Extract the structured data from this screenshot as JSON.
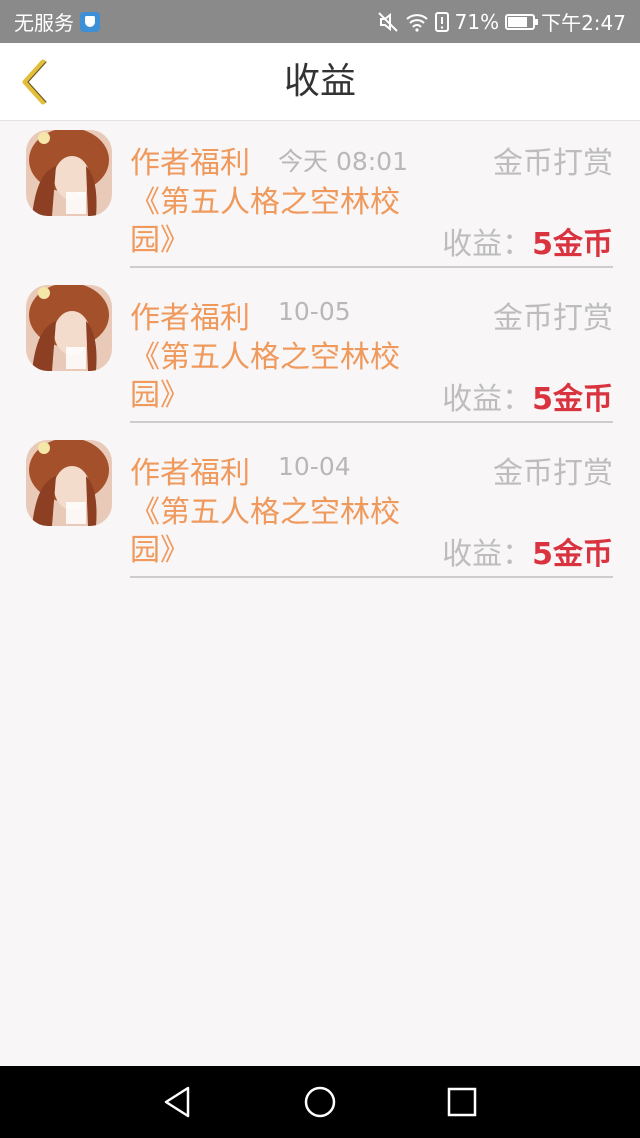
{
  "status_bar": {
    "carrier": "无服务",
    "battery": "71%",
    "battery_level": 0.71,
    "time": "下午2:47",
    "icons": [
      "shield-icon",
      "mute-icon",
      "wifi-icon",
      "alert-icon",
      "battery-icon"
    ]
  },
  "header": {
    "title": "收益",
    "back_icon": "chevron-left-icon",
    "back_color": "#e3bd3c"
  },
  "records": [
    {
      "welfare": "作者福利",
      "time": "今天 08:01",
      "type": "金币打赏",
      "book": "《第五人格之空林校园》",
      "income_label": "收益：",
      "income_value": "5金币"
    },
    {
      "welfare": "作者福利",
      "time": "10-05",
      "type": "金币打赏",
      "book": "《第五人格之空林校园》",
      "income_label": "收益：",
      "income_value": "5金币"
    },
    {
      "welfare": "作者福利",
      "time": "10-04",
      "type": "金币打赏",
      "book": "《第五人格之空林校园》",
      "income_label": "收益：",
      "income_value": "5金币"
    }
  ],
  "colors": {
    "accent_orange": "#ef9a5c",
    "income_red": "#d9333f",
    "muted_gray": "#bdbdbd"
  },
  "nav_bar": {
    "icons": [
      "back-triangle-icon",
      "home-circle-icon",
      "recents-square-icon"
    ]
  }
}
